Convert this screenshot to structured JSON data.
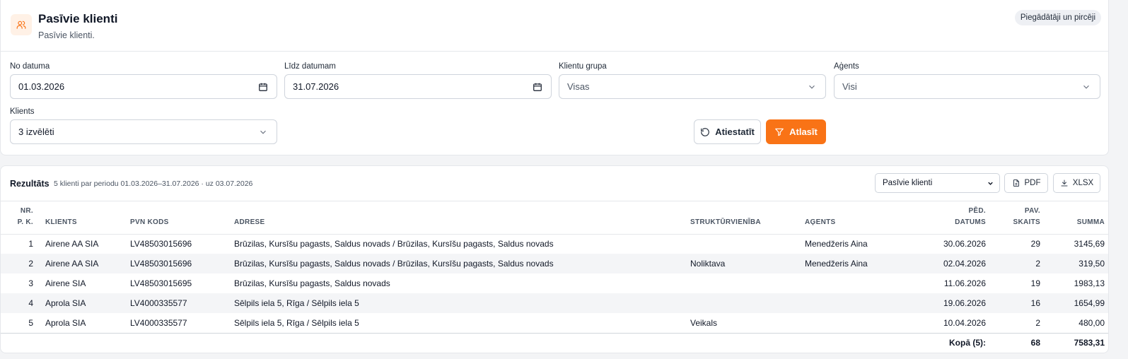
{
  "header": {
    "title": "Pasīvie klienti",
    "subtitle": "Pasīvie klienti.",
    "pill": "Piegādātāji un pircēji"
  },
  "filters": {
    "from_label": "No datuma",
    "from_value": "01.03.2026",
    "to_label": "Līdz datumam",
    "to_value": "31.07.2026",
    "group_label": "Klientu grupa",
    "group_value": "Visas",
    "agent_label": "Aģents",
    "agent_value": "Visi",
    "client_label": "Klients",
    "client_value": "3 izvēlēti",
    "reset_label": "Atiestatīt",
    "apply_label": "Atlasīt"
  },
  "results": {
    "title": "Rezultāts",
    "info": "5 klienti par periodu 01.03.2026–31.07.2026 · uz 03.07.2026",
    "report_select": "Pasīvie klienti",
    "pdf_label": "PDF",
    "xlsx_label": "XLSX",
    "columns": {
      "nr_1": "NR.",
      "nr_2": "P. K.",
      "client": "KLIENTS",
      "vat": "PVN KODS",
      "address": "ADRESE",
      "unit": "STRUKTŪRVIENĪBA",
      "agent": "AĢENTS",
      "date_1": "PĒD.",
      "date_2": "DATUMS",
      "count_1": "PAV.",
      "count_2": "SKAITS",
      "sum": "SUMMA"
    },
    "rows": [
      {
        "nr": "1",
        "client": "Airene AA SIA",
        "vat": "LV48503015696",
        "address": "Brūzilas, Kursīšu pagasts, Saldus novads / Brūzilas, Kursīšu pagasts, Saldus novads",
        "unit": "",
        "agent": "Menedžeris Aina",
        "date": "30.06.2026",
        "count": "29",
        "sum": "3145,69"
      },
      {
        "nr": "2",
        "client": "Airene AA SIA",
        "vat": "LV48503015696",
        "address": "Brūzilas, Kursīšu pagasts, Saldus novads / Brūzilas, Kursīšu pagasts, Saldus novads",
        "unit": "Noliktava",
        "agent": "Menedžeris Aina",
        "date": "02.04.2026",
        "count": "2",
        "sum": "319,50"
      },
      {
        "nr": "3",
        "client": "Airene SIA",
        "vat": "LV48503015695",
        "address": "Brūzilas, Kursīšu pagasts, Saldus novads",
        "unit": "",
        "agent": "",
        "date": "11.06.2026",
        "count": "19",
        "sum": "1983,13"
      },
      {
        "nr": "4",
        "client": "Aprola SIA",
        "vat": "LV4000335577",
        "address": "Sēlpils iela 5, Rīga / Sēlpils iela 5",
        "unit": "",
        "agent": "",
        "date": "19.06.2026",
        "count": "16",
        "sum": "1654,99"
      },
      {
        "nr": "5",
        "client": "Aprola SIA",
        "vat": "LV4000335577",
        "address": "Sēlpils iela 5, Rīga / Sēlpils iela 5",
        "unit": "Veikals",
        "agent": "",
        "date": "10.04.2026",
        "count": "2",
        "sum": "480,00"
      }
    ],
    "total_label": "Kopā (5):",
    "total_count": "68",
    "total_sum": "7583,31"
  },
  "colors": {
    "accent": "#f97316",
    "accent_soft": "#fff1e6"
  }
}
